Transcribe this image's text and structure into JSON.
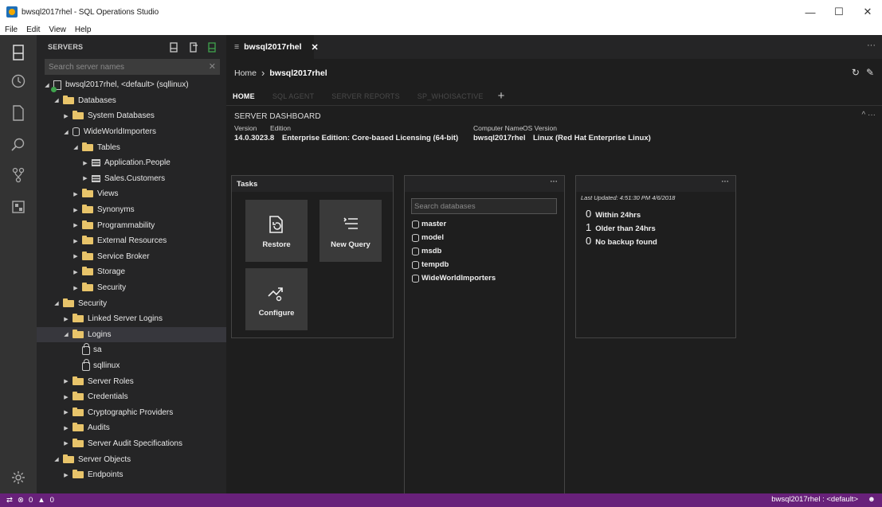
{
  "window": {
    "title": "bwsql2017rhel - SQL Operations Studio",
    "controls": [
      "—",
      "☐",
      "✕"
    ]
  },
  "menu": {
    "items": [
      "File",
      "Edit",
      "View",
      "Help"
    ]
  },
  "sidebar": {
    "header": "SERVERS",
    "search_placeholder": "Search server names",
    "tree": [
      {
        "label": "bwsql2017rhel, <default> (sqllinux)",
        "indent": 0,
        "icon": "server-icon",
        "twisty": "open"
      },
      {
        "label": "Databases",
        "indent": 1,
        "icon": "folder-icon",
        "twisty": "open"
      },
      {
        "label": "System Databases",
        "indent": 2,
        "icon": "folder-icon",
        "twisty": "closed"
      },
      {
        "label": "WideWorldImporters",
        "indent": 2,
        "icon": "database-icon",
        "twisty": "open"
      },
      {
        "label": "Tables",
        "indent": 3,
        "icon": "folder-icon",
        "twisty": "open"
      },
      {
        "label": "Application.People",
        "indent": 4,
        "icon": "table-icon",
        "twisty": "closed"
      },
      {
        "label": "Sales.Customers",
        "indent": 4,
        "icon": "table-icon",
        "twisty": "closed"
      },
      {
        "label": "Views",
        "indent": 3,
        "icon": "folder-icon",
        "twisty": "closed"
      },
      {
        "label": "Synonyms",
        "indent": 3,
        "icon": "folder-icon",
        "twisty": "closed"
      },
      {
        "label": "Programmability",
        "indent": 3,
        "icon": "folder-icon",
        "twisty": "closed"
      },
      {
        "label": "External Resources",
        "indent": 3,
        "icon": "folder-icon",
        "twisty": "closed"
      },
      {
        "label": "Service Broker",
        "indent": 3,
        "icon": "folder-icon",
        "twisty": "closed"
      },
      {
        "label": "Storage",
        "indent": 3,
        "icon": "folder-icon",
        "twisty": "closed"
      },
      {
        "label": "Security",
        "indent": 3,
        "icon": "folder-icon",
        "twisty": "closed"
      },
      {
        "label": "Security",
        "indent": 1,
        "icon": "folder-icon",
        "twisty": "open"
      },
      {
        "label": "Linked Server Logins",
        "indent": 2,
        "icon": "folder-icon",
        "twisty": "closed"
      },
      {
        "label": "Logins",
        "indent": 2,
        "icon": "folder-icon",
        "twisty": "open",
        "selected": true
      },
      {
        "label": "sa",
        "indent": 3,
        "icon": "lock-icon",
        "twisty": "none"
      },
      {
        "label": "sqllinux",
        "indent": 3,
        "icon": "lock-icon",
        "twisty": "none"
      },
      {
        "label": "Server Roles",
        "indent": 2,
        "icon": "folder-icon",
        "twisty": "closed"
      },
      {
        "label": "Credentials",
        "indent": 2,
        "icon": "folder-icon",
        "twisty": "closed"
      },
      {
        "label": "Cryptographic Providers",
        "indent": 2,
        "icon": "folder-icon",
        "twisty": "closed"
      },
      {
        "label": "Audits",
        "indent": 2,
        "icon": "folder-icon",
        "twisty": "closed"
      },
      {
        "label": "Server Audit Specifications",
        "indent": 2,
        "icon": "folder-icon",
        "twisty": "closed"
      },
      {
        "label": "Server Objects",
        "indent": 1,
        "icon": "folder-icon",
        "twisty": "open"
      },
      {
        "label": "Endpoints",
        "indent": 2,
        "icon": "folder-icon",
        "twisty": "closed"
      }
    ]
  },
  "editor": {
    "tab": {
      "label": "bwsql2017rhel",
      "close": "✕"
    },
    "more": "···",
    "breadcrumb": {
      "home": "Home",
      "current": "bwsql2017rhel"
    },
    "dashboard_tabs": [
      "HOME",
      "SQL AGENT",
      "SERVER REPORTS",
      "SP_WHOISACTIVE"
    ],
    "add_tab": "+",
    "server_dashboard": {
      "heading": "SERVER DASHBOARD",
      "properties": [
        {
          "label": "Version",
          "value": "14.0.3023.8"
        },
        {
          "label": "Edition",
          "value": "Enterprise Edition: Core-based Licensing (64-bit)"
        },
        {
          "label": "Computer Name",
          "value": "bwsql2017rhel"
        },
        {
          "label": "OS Version",
          "value": "Linux (Red Hat Enterprise Linux)"
        }
      ]
    },
    "tasks": {
      "title": "Tasks",
      "buttons": [
        {
          "label": "Restore",
          "icon": "restore-icon"
        },
        {
          "label": "New Query",
          "icon": "new-query-icon"
        },
        {
          "label": "Configure",
          "icon": "configure-icon"
        }
      ]
    },
    "databases": {
      "dots": "···",
      "search_placeholder": "Search databases",
      "items": [
        "master",
        "model",
        "msdb",
        "tempdb",
        "WideWorldImporters"
      ]
    },
    "backup": {
      "dots": "···",
      "last_updated": "Last Updated: 4:51:30 PM 4/6/2018",
      "rows": [
        {
          "count": "0",
          "label": "Within 24hrs"
        },
        {
          "count": "1",
          "label": "Older than 24hrs"
        },
        {
          "count": "0",
          "label": "No backup found"
        }
      ]
    }
  },
  "statusbar": {
    "errors": "0",
    "warnings": "0",
    "connection": "bwsql2017rhel : <default>"
  },
  "colors": {
    "statusbar": "#68217a",
    "activitybar": "#333333",
    "sidebar": "#252526",
    "editor": "#1e1e1e",
    "folder": "#e8c46a"
  }
}
